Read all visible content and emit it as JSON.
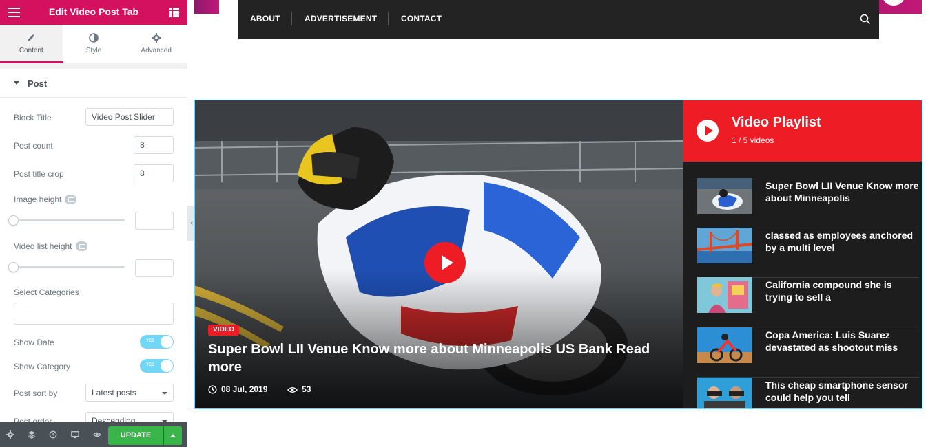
{
  "panel": {
    "title": "Edit Video Post Tab",
    "tabs": [
      {
        "label": "Content",
        "icon": "pencil-icon"
      },
      {
        "label": "Style",
        "icon": "contrast-icon"
      },
      {
        "label": "Advanced",
        "icon": "gear-icon"
      }
    ],
    "section_title": "Post",
    "controls": {
      "block_title_label": "Block Title",
      "block_title_value": "Video Post Slider",
      "post_count_label": "Post count",
      "post_count_value": "8",
      "title_crop_label": "Post title crop",
      "title_crop_value": "8",
      "image_height_label": "Image height",
      "video_list_height_label": "Video list height",
      "categories_label": "Select Categories",
      "show_date_label": "Show Date",
      "show_date_value": "YES",
      "show_category_label": "Show Category",
      "show_category_value": "YES",
      "sort_label": "Post sort by",
      "sort_value": "Latest posts",
      "order_label": "Post order",
      "order_value": "Descending"
    },
    "footer": {
      "update_label": "UPDATE"
    }
  },
  "nav": {
    "items": [
      "ABOUT",
      "ADVERTISEMENT",
      "CONTACT"
    ]
  },
  "hero": {
    "category": "VIDEO",
    "title": "Super Bowl LII Venue Know more about Minneapolis US Bank Read more",
    "date": "08 Jul, 2019",
    "views": "53"
  },
  "playlist": {
    "title": "Video Playlist",
    "count": "1 / 5 videos",
    "items": [
      {
        "title": "Super Bowl LII Venue Know more about Minneapolis"
      },
      {
        "title": "classed as employees anchored by a multi level"
      },
      {
        "title": "California compound she is trying to sell a"
      },
      {
        "title": "Copa America: Luis Suarez devastated as shootout miss"
      },
      {
        "title": "This cheap smartphone sensor could help you tell"
      }
    ]
  },
  "colors": {
    "brand": "#d3115f",
    "accent_red": "#ee1c25",
    "nav_bg": "#232323",
    "update_green": "#39b54a"
  }
}
